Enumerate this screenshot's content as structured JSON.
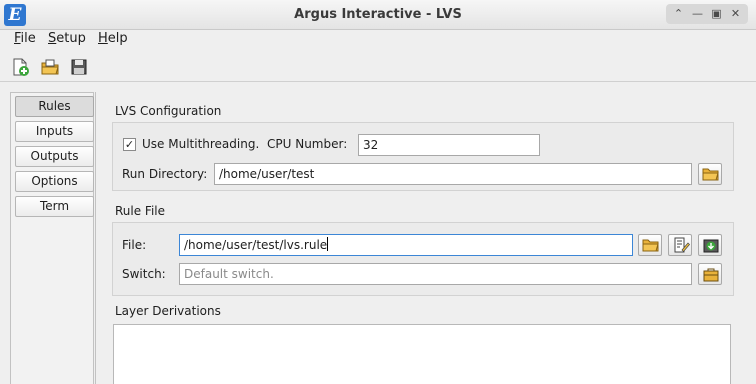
{
  "window": {
    "title": "Argus Interactive - LVS",
    "logo_letter": "E"
  },
  "menu": {
    "file": "File",
    "setup": "Setup",
    "help": "Help"
  },
  "toolbar": {
    "icons": [
      "new-file-icon",
      "open-folder-icon",
      "save-icon"
    ]
  },
  "sidebar": {
    "items": [
      "Rules",
      "Inputs",
      "Outputs",
      "Options",
      "Term"
    ],
    "active": "Rules"
  },
  "lvs_config": {
    "title": "LVS Configuration",
    "multithreading_label": "Use Multithreading.",
    "multithreading_checked": true,
    "cpu_label": "CPU Number:",
    "cpu_value": "32",
    "run_dir_label": "Run Directory:",
    "run_dir_value": "/home/user/test"
  },
  "rule_file": {
    "title": "Rule File",
    "file_label": "File:",
    "file_value": "/home/user/test/lvs.rule",
    "switch_label": "Switch:",
    "switch_placeholder": "Default switch."
  },
  "layer_derivations": {
    "title": "Layer Derivations"
  }
}
